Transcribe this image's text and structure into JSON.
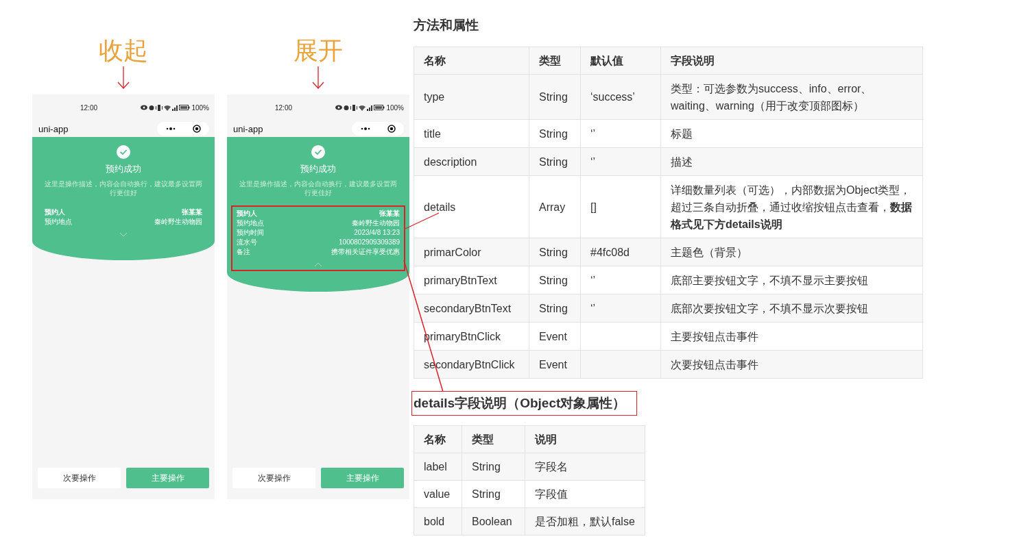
{
  "phones": [
    {
      "caption": "收起",
      "expanded": false,
      "details_highlighted": false,
      "status_time": "12:00",
      "battery": "100%",
      "nav_title": "uni-app",
      "title": "预约成功",
      "description": "这里是操作描述，内容会自动换行，建议最多设置两行更佳好",
      "details": [
        {
          "label": "预约人",
          "value": "张某某",
          "bold": true
        },
        {
          "label": "预约地点",
          "value": "秦岭野生动物园",
          "bold": false
        }
      ],
      "secondary_button": "次要操作",
      "primary_button": "主要操作"
    },
    {
      "caption": "展开",
      "expanded": true,
      "details_highlighted": true,
      "status_time": "12:00",
      "battery": "100%",
      "nav_title": "uni-app",
      "title": "预约成功",
      "description": "这里是操作描述，内容会自动换行，建议最多设置两行更佳好",
      "details": [
        {
          "label": "预约人",
          "value": "张某某",
          "bold": true
        },
        {
          "label": "预约地点",
          "value": "秦岭野生动物园",
          "bold": false
        },
        {
          "label": "预约时间",
          "value": "2023/4/8 13:23",
          "bold": false
        },
        {
          "label": "流水号",
          "value": "1000802909309389",
          "bold": false
        },
        {
          "label": "备注",
          "value": "携带相关证件享受优惠",
          "bold": false
        }
      ],
      "secondary_button": "次要操作",
      "primary_button": "主要操作"
    }
  ],
  "doc": {
    "heading": "方法和属性",
    "table": {
      "columns": [
        "名称",
        "类型",
        "默认值",
        "字段说明"
      ],
      "rows": [
        [
          "type",
          "String",
          "‘success’",
          "类型：可选参数为success、info、error、waiting、warning（用于改变顶部图标）"
        ],
        [
          "title",
          "String",
          "‘’",
          "标题"
        ],
        [
          "description",
          "String",
          "‘’",
          "描述"
        ],
        [
          "details",
          "Array",
          "[]",
          "详细数量列表（可选），内部数据为Object类型，超过三条自动折叠，通过收缩按钮点击查看，**数据格式见下方details说明**"
        ],
        [
          "primarColor",
          "String",
          "#4fc08d",
          "主题色（背景）"
        ],
        [
          "primaryBtnText",
          "String",
          "‘’",
          "底部主要按钮文字，不填不显示主要按钮"
        ],
        [
          "secondaryBtnText",
          "String",
          "‘’",
          "底部次要按钮文字，不填不显示次要按钮"
        ],
        [
          "primaryBtnClick",
          "Event",
          "",
          "主要按钮点击事件"
        ],
        [
          "secondaryBtnClick",
          "Event",
          "",
          "次要按钮点击事件"
        ]
      ]
    },
    "subheading": "details字段说明（Object对象属性）",
    "subheading_highlighted": true,
    "table2": {
      "columns": [
        "名称",
        "类型",
        "说明"
      ],
      "rows": [
        [
          "label",
          "String",
          "字段名"
        ],
        [
          "value",
          "String",
          "字段值"
        ],
        [
          "bold",
          "Boolean",
          "是否加粗，默认false"
        ]
      ]
    }
  }
}
